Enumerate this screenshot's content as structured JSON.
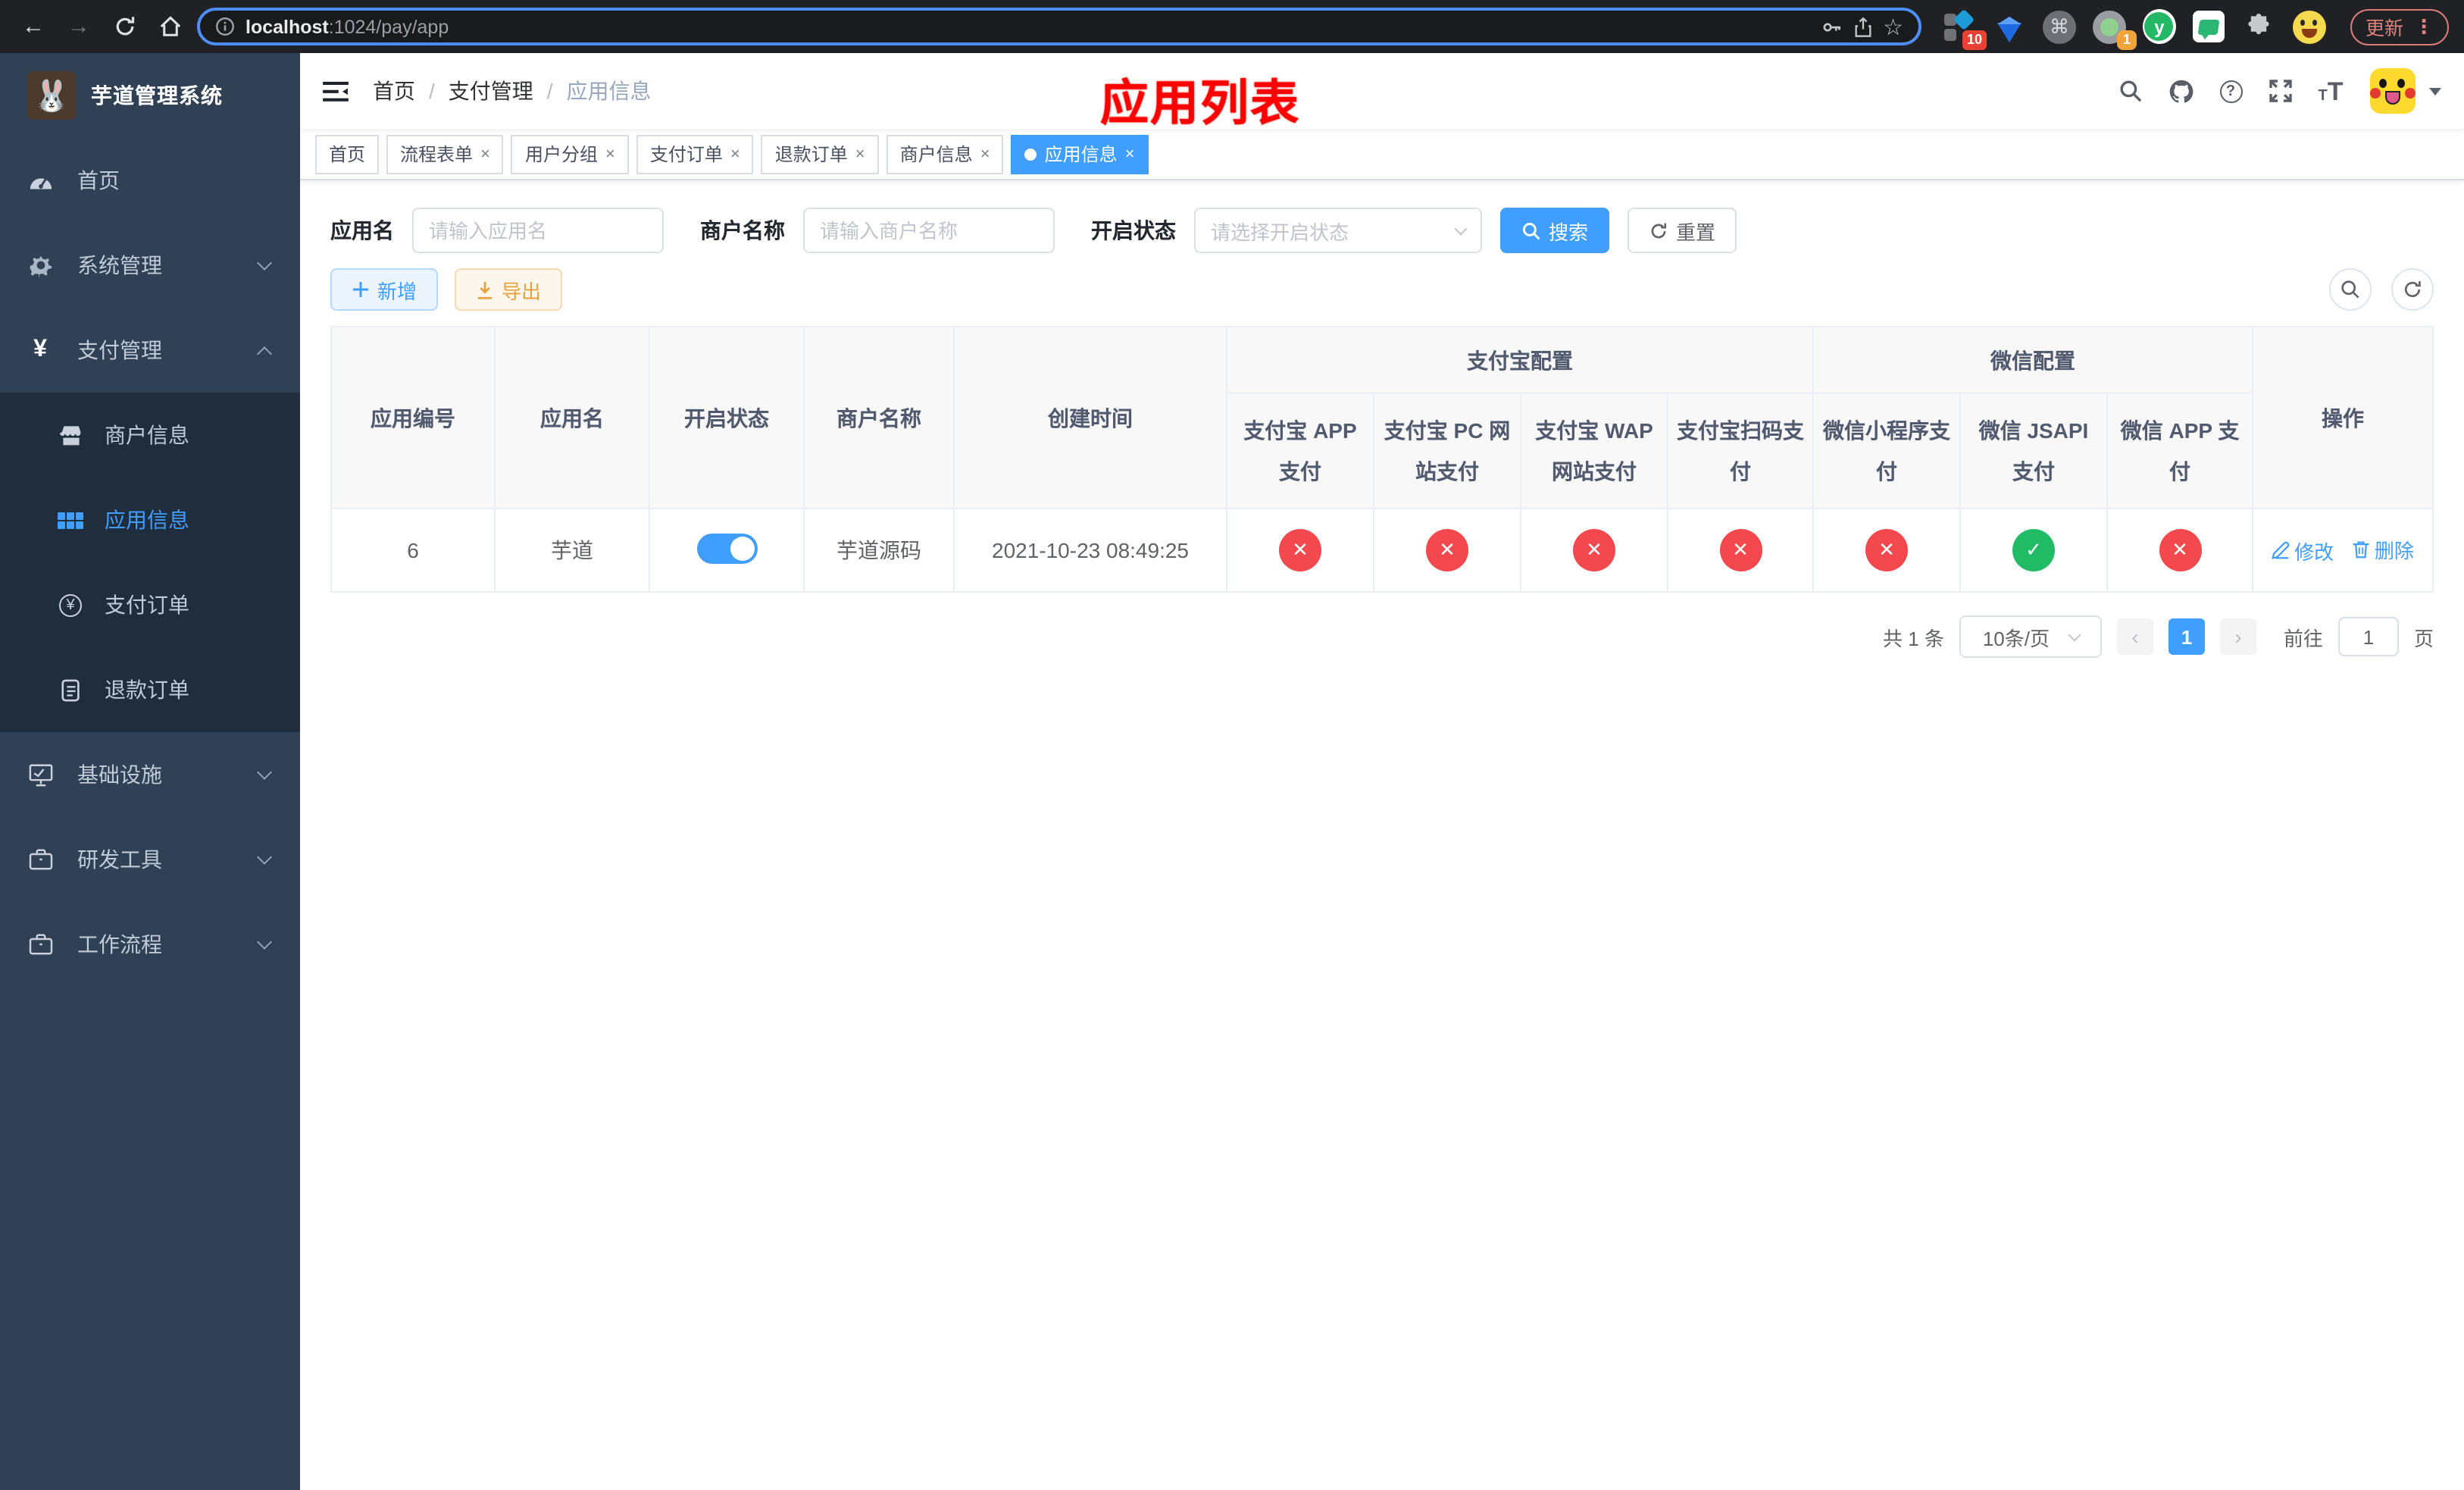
{
  "browser": {
    "url_host": "localhost",
    "url_path": ":1024/pay/app",
    "update_label": "更新",
    "menu_dots": "⋮",
    "ext_badge_10": "10",
    "ext_badge_1": "1"
  },
  "sidebar": {
    "title": "芋道管理系统",
    "items": [
      {
        "label": "首页"
      },
      {
        "label": "系统管理"
      },
      {
        "label": "支付管理"
      },
      {
        "label": "商户信息"
      },
      {
        "label": "应用信息"
      },
      {
        "label": "支付订单"
      },
      {
        "label": "退款订单"
      },
      {
        "label": "基础设施"
      },
      {
        "label": "研发工具"
      },
      {
        "label": "工作流程"
      }
    ]
  },
  "navbar": {
    "breadcrumb": [
      "首页",
      "支付管理",
      "应用信息"
    ],
    "separator": "/"
  },
  "overlay_title": "应用列表",
  "tabs": [
    {
      "label": "首页"
    },
    {
      "label": "流程表单"
    },
    {
      "label": "用户分组"
    },
    {
      "label": "支付订单"
    },
    {
      "label": "退款订单"
    },
    {
      "label": "商户信息"
    },
    {
      "label": "应用信息"
    }
  ],
  "filters": {
    "app_name_label": "应用名",
    "app_name_placeholder": "请输入应用名",
    "merchant_label": "商户名称",
    "merchant_placeholder": "请输入商户名称",
    "status_label": "开启状态",
    "status_placeholder": "请选择开启状态",
    "search_label": "搜索",
    "reset_label": "重置"
  },
  "toolbar": {
    "add_label": "新增",
    "export_label": "导出"
  },
  "table": {
    "columns": [
      "应用编号",
      "应用名",
      "开启状态",
      "商户名称",
      "创建时间"
    ],
    "groups": [
      {
        "label": "支付宝配置",
        "children": [
          "支付宝 APP 支付",
          "支付宝 PC 网站支付",
          "支付宝 WAP 网站支付",
          "支付宝扫码支付"
        ]
      },
      {
        "label": "微信配置",
        "children": [
          "微信小程序支付",
          "微信 JSAPI 支付",
          "微信 APP 支付"
        ]
      }
    ],
    "actions_column": "操作",
    "row": {
      "id": "6",
      "name": "芋道",
      "enabled": true,
      "merchant": "芋道源码",
      "created_at": "2021-10-23 08:49:25",
      "statuses": [
        false,
        false,
        false,
        false,
        false,
        true,
        false
      ],
      "edit_label": "修改",
      "delete_label": "删除"
    }
  },
  "icons": {
    "check": "✓",
    "cross": "✕",
    "close": "×",
    "back": "←",
    "forward": "→",
    "star": "☆",
    "question": "?",
    "yen": "¥",
    "command": "⌘",
    "puzzle": "⬣",
    "prev": "‹",
    "next": "›"
  },
  "pagination": {
    "total": "共 1 条",
    "page_size": "10条/页",
    "page": "1",
    "goto_label": "前往",
    "goto_value": "1",
    "page_unit": "页"
  },
  "colors": {
    "accent": "#409eff",
    "success": "#21ba65",
    "danger": "#f3494e",
    "warning": "#e6a23c",
    "sidebar_bg": "#304156",
    "submenu_bg": "#1f2d3d",
    "title_red": "#fd0100"
  }
}
